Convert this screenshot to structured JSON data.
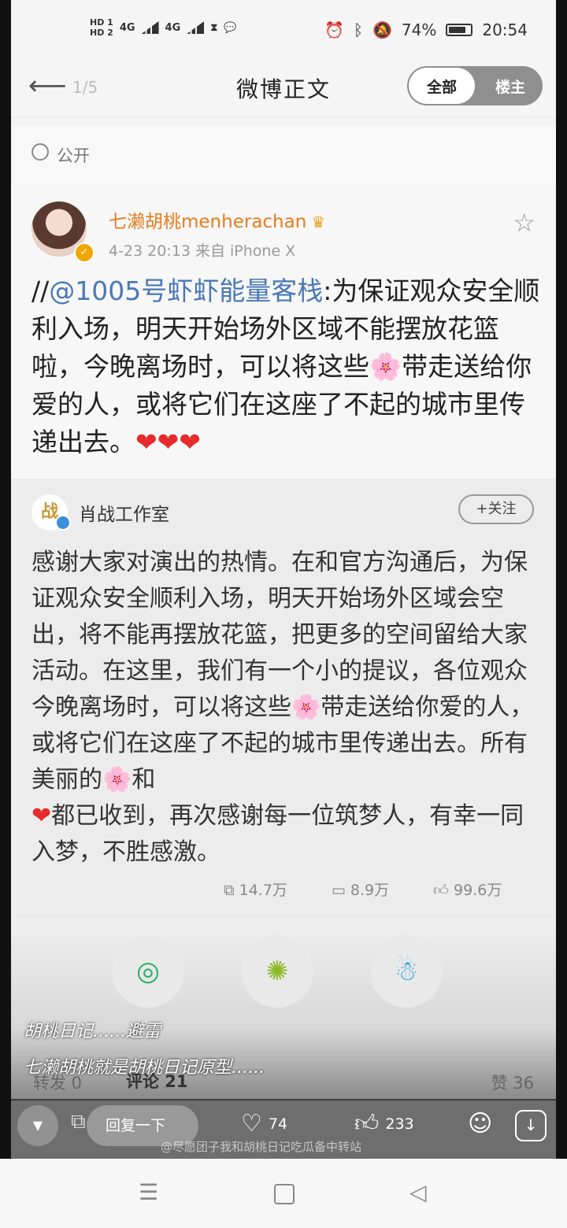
{
  "status_bar": {
    "network_hd": [
      "HD 1",
      "HD 2"
    ],
    "network_type": [
      "4G",
      "4G"
    ],
    "battery_percent": "74%",
    "time": "20:54"
  },
  "nav": {
    "back_icon": "arrow-left-icon",
    "page_indicator": "1/5",
    "title": "微博正文",
    "segment": {
      "all": "全部",
      "owner": "楼主"
    }
  },
  "visibility": {
    "label": "公开"
  },
  "post": {
    "username": "七濑胡桃menherachan",
    "timestamp": "4-23 20:13",
    "source": "来自 iPhone X",
    "text_prefix": "//",
    "mention": "@1005号虾虾能量客栈",
    "text_body": ":为保证观众安全顺利入场，明天开始场外区域不能摆放花篮啦，今晚离场时，可以将这些",
    "flower_emoji": "🌸",
    "text_body2": "带走送给你爱的人，或将它们在这座了不起的城市里传递出去。",
    "hearts": "❤❤❤"
  },
  "retweet": {
    "author": "肖战工作室",
    "avatar_char": "战",
    "follow_label": "+关注",
    "text_1": "感谢大家对演出的热情。在和官方沟通后，为保证观众安全顺利入场，明天开始场外区域会空出，将不能再摆放花篮，把更多的空间留给大家活动。在这里，我们有一个小的提议，各位观众今晚离场时，可以将这些",
    "flower": "🌸",
    "text_2": "带走送给你爱的人，或将它们在这座了不起的城市里传递出去。所有美丽的",
    "text_3": "和",
    "heart": "❤",
    "text_4": "都已收到，再次感谢每一位筑梦人，有幸一同入梦，不胜感激。",
    "stats": {
      "reposts": "14.7万",
      "comments": "8.9万",
      "likes": "99.6万"
    }
  },
  "share": [
    "wechat-icon",
    "moments-icon",
    "qq-icon"
  ],
  "danmu": [
    "胡桃日记......避雷",
    "七濑胡桃就是胡桃日记原型......"
  ],
  "tabs": {
    "forward": "转发 0",
    "comments": "评论 21",
    "likes": "赞 36"
  },
  "player": {
    "reply_placeholder": "回复一下",
    "forward_label": "转发",
    "comment_count": "74",
    "like_count": "233",
    "watermark": "@尽愿团子我和胡桃日记吃瓜备中转站"
  }
}
